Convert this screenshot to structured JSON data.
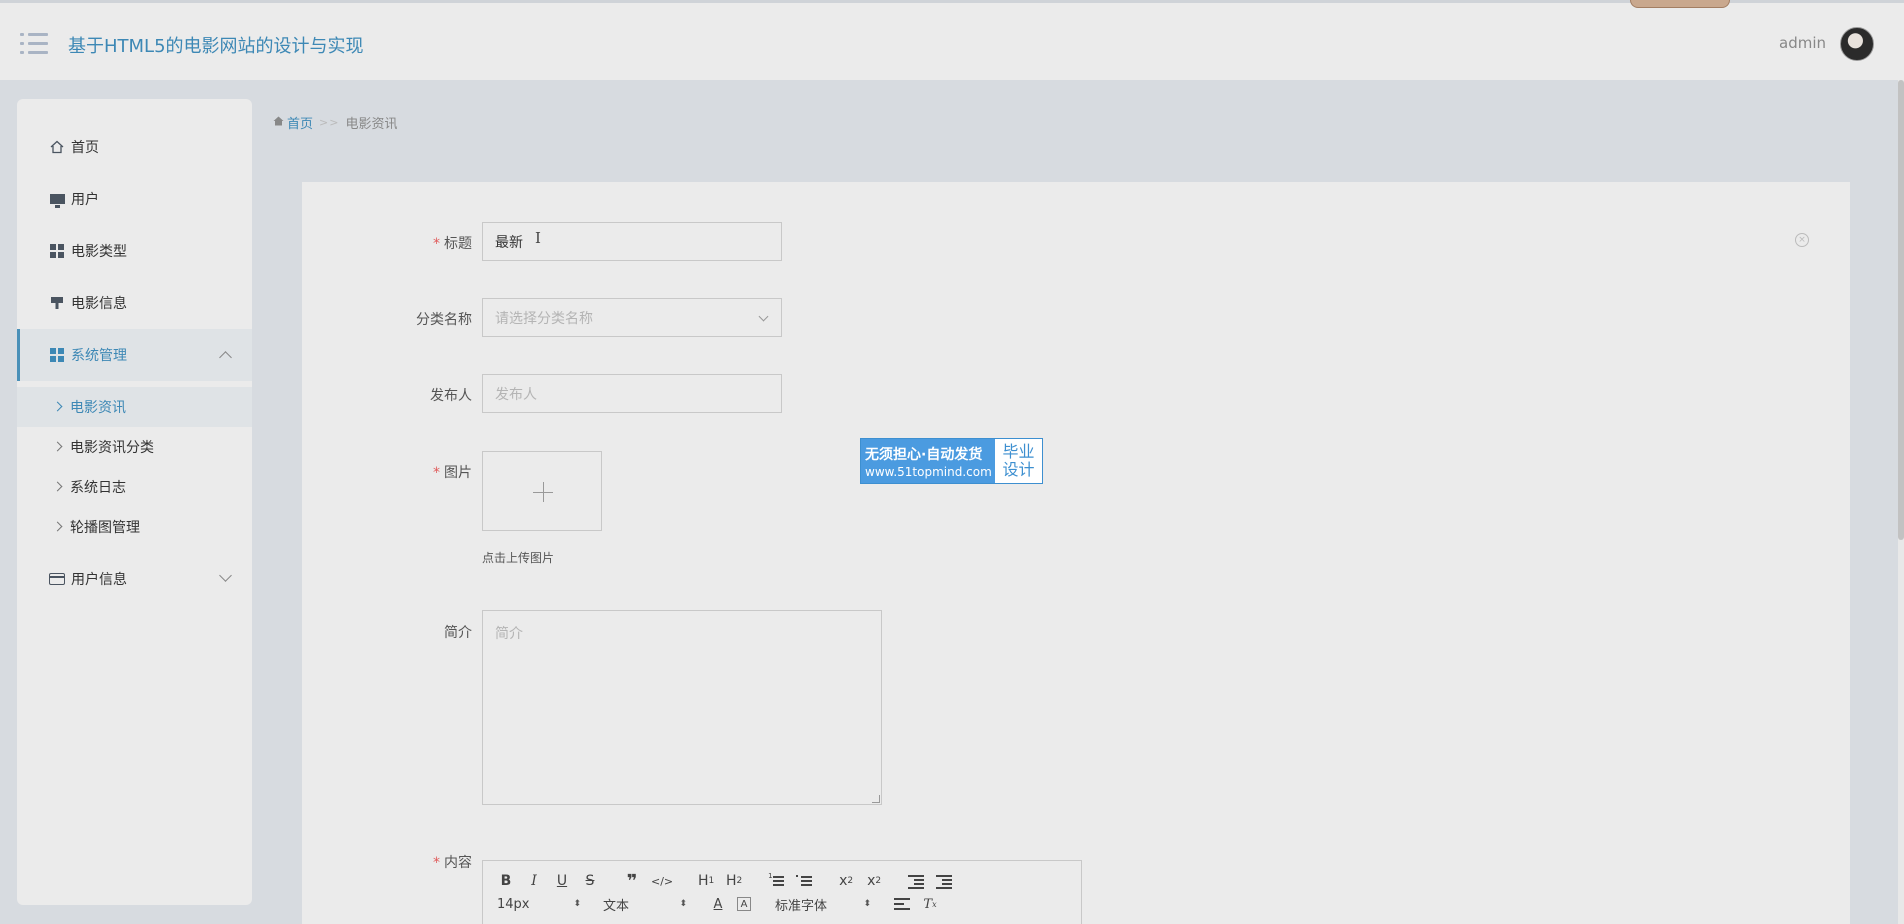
{
  "header": {
    "app_title": "基于HTML5的电影网站的设计与实现",
    "user_name": "admin"
  },
  "sidebar": {
    "items": [
      {
        "label": "首页",
        "icon": "home-icon"
      },
      {
        "label": "用户",
        "icon": "monitor-icon"
      },
      {
        "label": "电影类型",
        "icon": "grid-icon"
      },
      {
        "label": "电影信息",
        "icon": "paint-brush-icon"
      },
      {
        "label": "系统管理",
        "icon": "grid-icon",
        "expanded": true
      },
      {
        "label": "用户信息",
        "icon": "card-icon",
        "expanded": false
      }
    ],
    "sub_items": [
      {
        "label": "电影资讯",
        "active": true
      },
      {
        "label": "电影资讯分类"
      },
      {
        "label": "系统日志"
      },
      {
        "label": "轮播图管理"
      }
    ]
  },
  "breadcrumb": {
    "home": "首页",
    "separator": ">>",
    "current": "电影资讯"
  },
  "form": {
    "title_label": "标题",
    "title_value": "最新",
    "category_label": "分类名称",
    "category_placeholder": "请选择分类名称",
    "publisher_label": "发布人",
    "publisher_placeholder": "发布人",
    "image_label": "图片",
    "upload_hint": "点击上传图片",
    "intro_label": "简介",
    "intro_placeholder": "简介",
    "content_label": "内容",
    "required_mark": "*"
  },
  "editor": {
    "font_size": "14px",
    "block_type": "文本",
    "font_family": "标准字体"
  },
  "watermark": {
    "line1": "无须担心·自动发货",
    "line2": "www.51topmind.com",
    "right1": "毕业",
    "right2": "设计"
  },
  "colors": {
    "accent": "#3d88b5",
    "required": "#e05a5a",
    "watermark_blue": "#4b9be0"
  }
}
